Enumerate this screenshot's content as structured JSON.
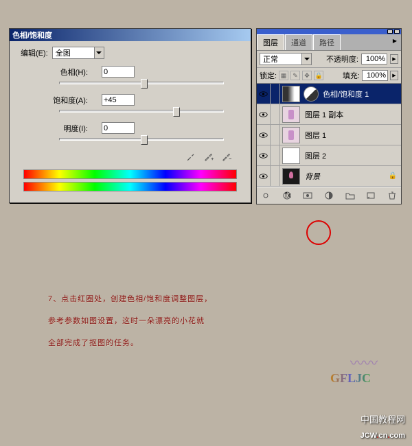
{
  "dialog": {
    "title": "色相/饱和度",
    "edit_label": "编辑(E):",
    "edit_value": "全图",
    "sliders": {
      "hue": {
        "label": "色相(H):",
        "value": "0",
        "pos": 118
      },
      "sat": {
        "label": "饱和度(A):",
        "value": "+45",
        "pos": 165
      },
      "light": {
        "label": "明度(I):",
        "value": "0",
        "pos": 118
      }
    }
  },
  "panel": {
    "tabs": [
      "图层",
      "通道",
      "路径"
    ],
    "blend_mode": "正常",
    "opacity_label": "不透明度:",
    "opacity_value": "100%",
    "lock_label": "锁定:",
    "fill_label": "填充:",
    "fill_value": "100%",
    "layers": [
      {
        "name": "色相/饱和度 1",
        "type": "adj",
        "selected": true
      },
      {
        "name": "图层 1 副本",
        "type": "flower"
      },
      {
        "name": "图层 1",
        "type": "flower"
      },
      {
        "name": "图层 2",
        "type": "white"
      },
      {
        "name": "背景",
        "type": "bg",
        "italic": true,
        "locked": true
      }
    ]
  },
  "caption": {
    "line1": "7、点击红圈处，创建色相/饱和度调整图层，",
    "line2": "参考参数如图设置，这时一朵漂亮的小花就",
    "line3": "全部完成了抠图的任务。"
  },
  "logo": "GFLJC",
  "watermark1": "中国教程网",
  "watermark2_a": "JCW",
  "watermark2_b": "cn",
  "watermark2_c": "com"
}
